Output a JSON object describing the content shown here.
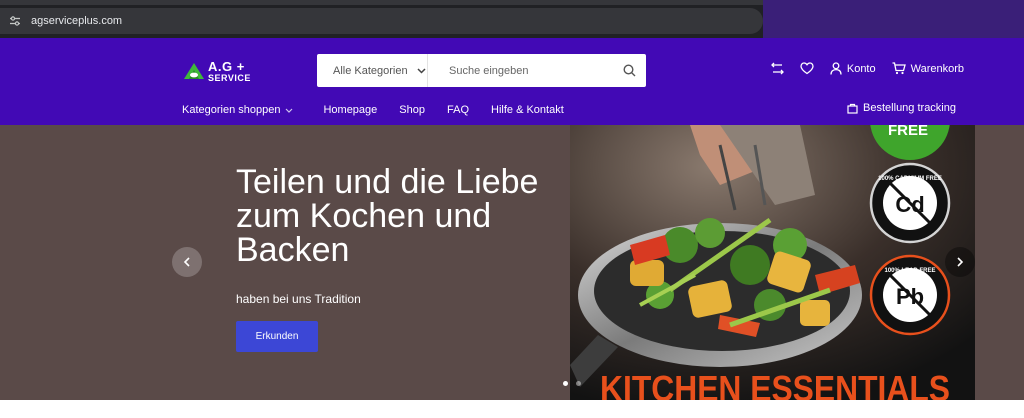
{
  "browser": {
    "url": "agserviceplus.com"
  },
  "header": {
    "logo": {
      "line1": "A.G +",
      "line2": "SERVICE"
    },
    "search": {
      "category_label": "Alle Kategorien",
      "placeholder": "Suche eingeben"
    },
    "actions": {
      "account_label": "Konto",
      "cart_label": "Warenkorb"
    },
    "nav": {
      "shop_categories": "Kategorien shoppen",
      "items": [
        "Homepage",
        "Shop",
        "FAQ",
        "Hilfe & Kontakt"
      ],
      "tracking": "Bestellung tracking"
    }
  },
  "hero": {
    "title_lines": [
      "Teilen und die Liebe",
      "zum Kochen und",
      "Backen"
    ],
    "subtitle": "haben bei uns Tradition",
    "cta_label": "Erkunden",
    "slide_count": 2,
    "active_slide": 1,
    "image": {
      "badge_top": "FREE",
      "badge_cadmium_symbol": "Cd",
      "badge_cadmium_text": "100% CADMIUM FREE",
      "badge_lead_symbol": "Pb",
      "badge_lead_text": "100% LEAD FREE",
      "banner_text": "KITCHEN ESSENTIALS"
    }
  },
  "colors": {
    "header_bg": "#4209b5",
    "hero_bg": "#5a4a48",
    "cta_bg": "#3c47d6",
    "badge_green": "#3fa52c",
    "banner_orange": "#e8501c"
  }
}
